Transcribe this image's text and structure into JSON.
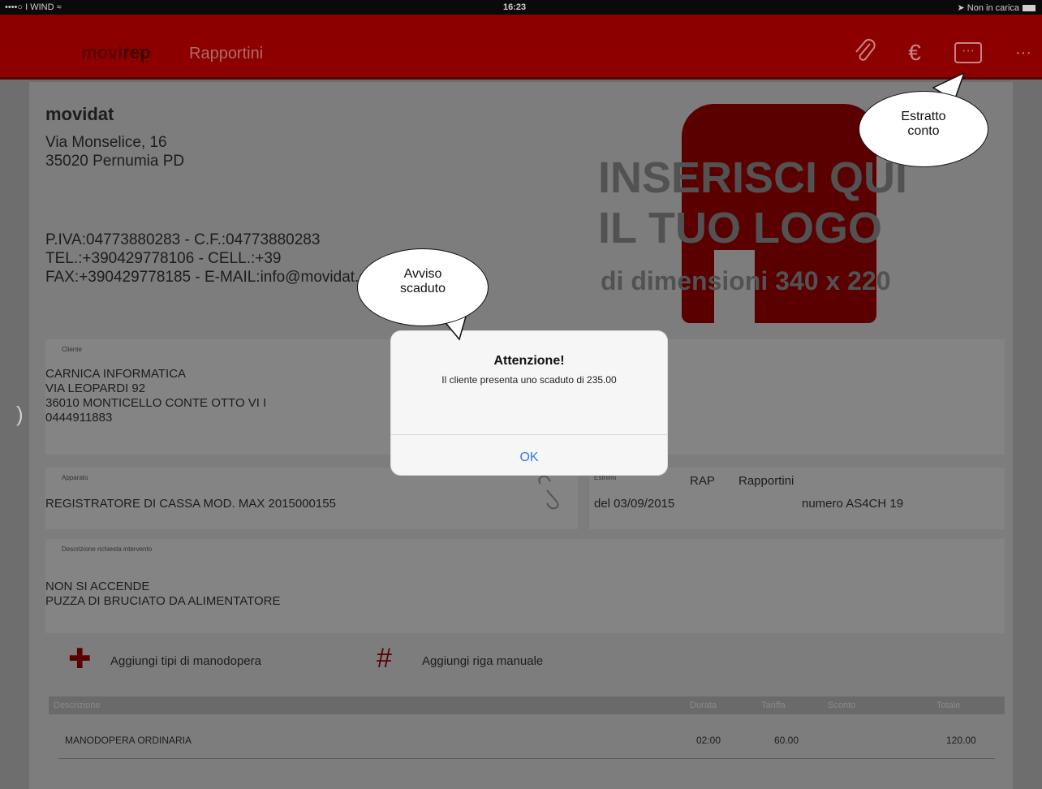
{
  "status_bar": {
    "carrier": "••••○ I WIND ≈",
    "time": "16:23",
    "charge": "➤ Non in carica"
  },
  "app_bar": {
    "brand_a": "movi",
    "brand_b": "rep",
    "title": "Rapportini",
    "icons": [
      "paperclip-icon",
      "euro-icon",
      "chat-icon",
      "more-icon"
    ]
  },
  "company": {
    "name": "movidat",
    "address_1": "Via Monselice, 16",
    "address_2": "35020 Pernumia PD",
    "tax_line": "P.IVA:04773880283 - C.F.:04773880283",
    "tel_line": "TEL.:+390429778106 - CELL.:+39",
    "fax_line": "FAX:+390429778185 - E-MAIL:info@movidat.com"
  },
  "logo_placeholder": {
    "line1": "INSERISCI QUI",
    "line2": "IL TUO LOGO",
    "line3": "di dimensioni 340 x 220"
  },
  "cliente": {
    "label": "Cliente",
    "lines": [
      "CARNICA INFORMATICA",
      "VIA LEOPARDI 92",
      "36010 MONTICELLO CONTE OTTO VI I",
      "0444911883"
    ]
  },
  "apparato": {
    "label": "Apparato",
    "value": "REGISTRATORE DI CASSA MOD. MAX 2015000155"
  },
  "estremi": {
    "label": "Estremi",
    "code": "RAP",
    "type": "Rapportini",
    "date": "del 03/09/2015",
    "number": "numero AS4CH 19"
  },
  "descrizione": {
    "label": "Descrizione richiesta intervento",
    "line1": "NON SI ACCENDE",
    "line2": "PUZZA DI BRUCIATO DA ALIMENTATORE"
  },
  "actions": {
    "add_labor": "Aggiungi tipi di manodopera",
    "add_manual": "Aggiungi riga manuale"
  },
  "table": {
    "headers": [
      "Descrizione",
      "Durata",
      "Tariffa",
      "Sconto",
      "Totale"
    ],
    "rows": [
      {
        "descrizione": "MANODOPERA ORDINARIA",
        "durata": "02:00",
        "tariffa": "60.00",
        "sconto": "",
        "totale": "120.00"
      }
    ]
  },
  "alert": {
    "title": "Attenzione!",
    "message": "Il cliente presenta uno scaduto di 235.00",
    "ok": "OK"
  },
  "callouts": {
    "avviso_1": "Avviso",
    "avviso_2": "scaduto",
    "estratto_1": "Estratto",
    "estratto_2": "conto"
  },
  "colors": {
    "app_bar": "#8d0000",
    "alert_button": "#2f7cf6"
  }
}
